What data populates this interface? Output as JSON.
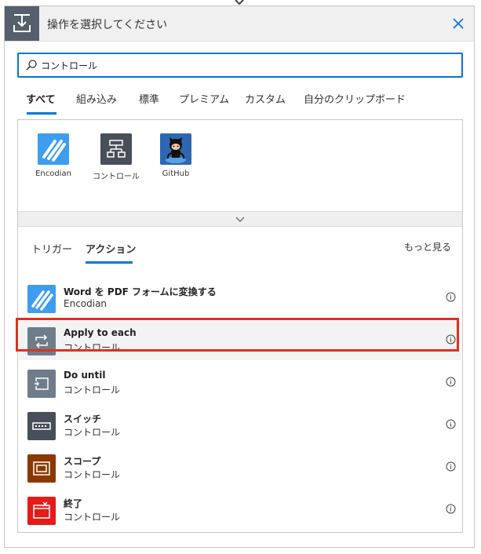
{
  "header": {
    "title": "操作を選択してください",
    "icon": "connector-step-icon",
    "close_icon": "close-icon"
  },
  "search": {
    "value": "コントロール",
    "icon": "search-icon"
  },
  "tabs": [
    {
      "label": "すべて",
      "active": true
    },
    {
      "label": "組み込み",
      "active": false
    },
    {
      "label": "標準",
      "active": false
    },
    {
      "label": "プレミアム",
      "active": false
    },
    {
      "label": "カスタム",
      "active": false
    },
    {
      "label": "自分のクリップボード",
      "active": false
    }
  ],
  "connectors": [
    {
      "label": "Encodian",
      "icon": "encodian-icon",
      "color": "#3d9df0"
    },
    {
      "label": "コントロール",
      "icon": "control-icon",
      "color": "#484f58"
    },
    {
      "label": "GitHub",
      "icon": "github-icon",
      "color": "#2e67b1"
    }
  ],
  "sub_tabs": [
    {
      "label": "トリガー",
      "active": false
    },
    {
      "label": "アクション",
      "active": true
    }
  ],
  "see_more": "もっと見る",
  "actions": [
    {
      "title": "Word を PDF フォームに変換する",
      "subtitle": "Encodian",
      "icon": "encodian-icon",
      "color": "#3d9df0"
    },
    {
      "title": "Apply to each",
      "subtitle": "コントロール",
      "icon": "loop-icon",
      "color": "#6f7c8a",
      "highlighted": true
    },
    {
      "title": "Do until",
      "subtitle": "コントロール",
      "icon": "do-until-icon",
      "color": "#6f7c8a"
    },
    {
      "title": "スイッチ",
      "subtitle": "コントロール",
      "icon": "switch-icon",
      "color": "#484f58"
    },
    {
      "title": "スコープ",
      "subtitle": "コントロール",
      "icon": "scope-icon",
      "color": "#8c3900"
    },
    {
      "title": "終了",
      "subtitle": "コントロール",
      "icon": "terminate-icon",
      "color": "#e41b17"
    }
  ],
  "accent_color": "#0078d4",
  "highlight_border_color": "#e0301e"
}
